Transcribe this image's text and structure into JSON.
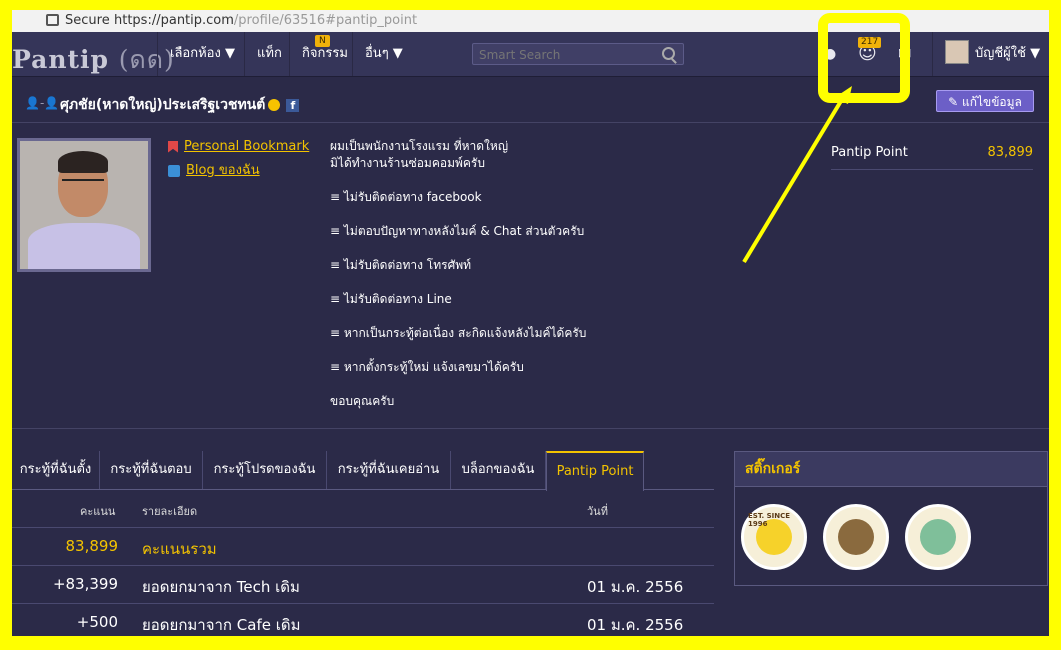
{
  "browser": {
    "secure_label": "Secure",
    "url_main": "https://pantip.com",
    "url_rest": "/profile/63516#pantip_point"
  },
  "nav": {
    "logo_text": "Pantip",
    "logo_mark": "(ดด)",
    "items": [
      {
        "label": "เลือกห้อง ▼"
      },
      {
        "label": "แท็ก"
      },
      {
        "label": "กิจกรรม",
        "badge": "N"
      },
      {
        "label": "อื่นๆ ▼"
      }
    ],
    "search_placeholder": "Smart Search",
    "notification_count": "217",
    "account_label": "บัญชีผู้ใช้ ▼"
  },
  "profile": {
    "name": "ศุภชัย(หาดใหญ่)ประเสริฐเวชทนต์",
    "edit_button": "แก้ไขข้อมูล",
    "links": {
      "bookmark": "Personal Bookmark",
      "blog": "Blog ของฉัน"
    },
    "about": [
      "ผมเป็นพนักงานโรงแรม ที่หาดใหญ่",
      "มิได้ทำงานร้านซ่อมคอมพ์ครับ",
      "≡ ไม่รับติดต่อทาง facebook",
      "≡ ไม่ตอบปัญหาทางหลังไมค์ & Chat ส่วนตัวครับ",
      "≡ ไม่รับติดต่อทาง โทรศัพท์",
      "≡ ไม่รับติดต่อทาง Line",
      "≡ หากเป็นกระทู้ต่อเนื่อง สะกิดแจ้งหลังไมค์ได้ครับ",
      "≡ หากตั้งกระทู้ใหม่ แจ้งเลขมาได้ครับ",
      "ขอบคุณครับ"
    ],
    "pantip_point_label": "Pantip Point",
    "pantip_point_value": "83,899"
  },
  "tabs": [
    {
      "label": "กระทู้ที่ฉันตั้ง"
    },
    {
      "label": "กระทู้ที่ฉันตอบ"
    },
    {
      "label": "กระทู้โปรดของฉัน"
    },
    {
      "label": "กระทู้ที่ฉันเคยอ่าน"
    },
    {
      "label": "บล็อกของฉัน"
    },
    {
      "label": "Pantip Point"
    }
  ],
  "points_table": {
    "headers": {
      "points": "คะแนน",
      "detail": "รายละเอียด",
      "date": "วันที่"
    },
    "rows": [
      {
        "points": "83,899",
        "detail": "คะแนนรวม",
        "date": ""
      },
      {
        "points": "+83,399",
        "detail": "ยอดยกมาจาก Tech เดิม",
        "date": "01 ม.ค. 2556"
      },
      {
        "points": "+500",
        "detail": "ยอดยกมาจาก Cafe เดิม",
        "date": "01 ม.ค. 2556"
      }
    ]
  },
  "stickers": {
    "title": "สติ๊กเกอร์",
    "items": [
      {
        "text": "EST. SINCE 1996"
      }
    ]
  },
  "colors": {
    "accent": "#f3c300",
    "background": "#2b2a48",
    "annotation": "#ffff00"
  }
}
